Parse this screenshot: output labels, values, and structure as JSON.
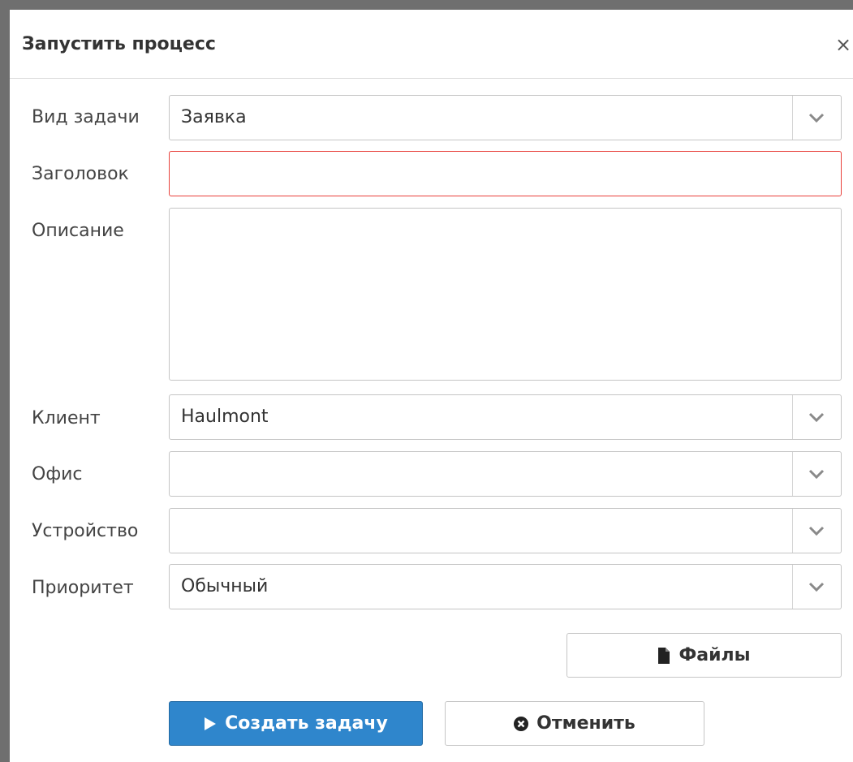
{
  "dialog": {
    "title": "Запустить процесс",
    "close_glyph": "×"
  },
  "form": {
    "task_type": {
      "label": "Вид задачи",
      "value": "Заявка"
    },
    "title": {
      "label": "Заголовок",
      "value": ""
    },
    "description": {
      "label": "Описание",
      "value": ""
    },
    "client": {
      "label": "Клиент",
      "value": "Haulmont"
    },
    "office": {
      "label": "Офис",
      "value": ""
    },
    "device": {
      "label": "Устройство",
      "value": ""
    },
    "priority": {
      "label": "Приоритет",
      "value": "Обычный"
    }
  },
  "buttons": {
    "files": {
      "label": "Файлы",
      "icon": "file-icon"
    },
    "create": {
      "label": "Создать задачу",
      "icon": "play-icon"
    },
    "cancel": {
      "label": "Отменить",
      "icon": "times-circle-icon"
    }
  },
  "colors": {
    "primary": "#2f86cc",
    "error_border": "#e8403a",
    "frame": "#6f6f6f"
  }
}
